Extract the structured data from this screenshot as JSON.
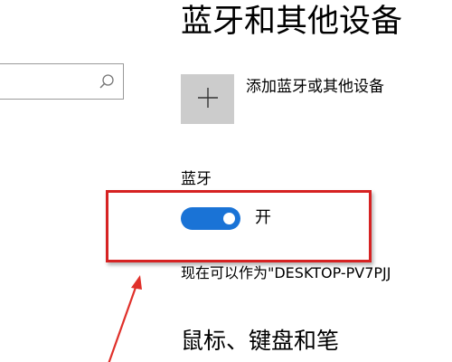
{
  "page_title": "蓝牙和其他设备",
  "search": {
    "icon": "search-icon"
  },
  "add_device": {
    "icon": "plus-icon",
    "label": "添加蓝牙或其他设备"
  },
  "bluetooth": {
    "label": "蓝牙",
    "toggle_on": true,
    "state_label": "开",
    "discoverable_text": "现在可以作为\"DESKTOP-PV7PJJ"
  },
  "section_title": "鼠标、键盘和笔",
  "colors": {
    "toggle_accent": "#1a73d6",
    "highlight": "#d62222",
    "add_button_bg": "#cccccc"
  }
}
